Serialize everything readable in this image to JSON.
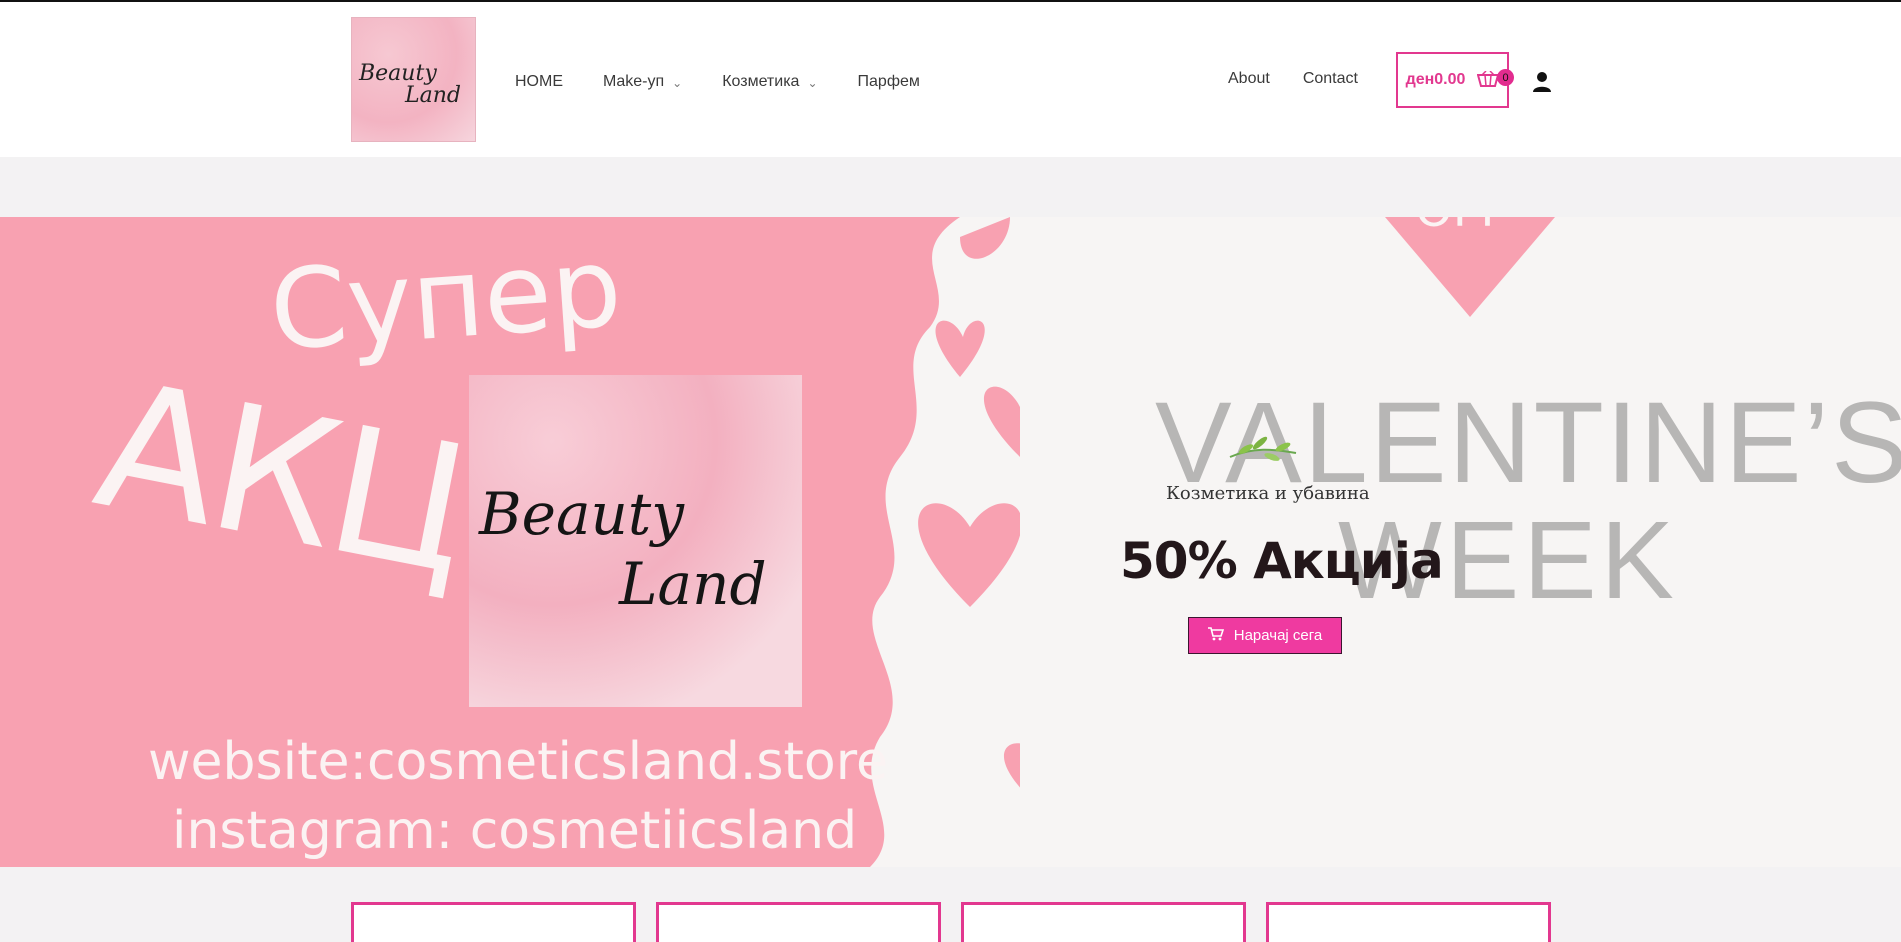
{
  "header": {
    "logo": {
      "line1": "Beauty",
      "line2": "Land"
    },
    "nav": [
      {
        "label": "HOME",
        "has_dropdown": false
      },
      {
        "label": "Make-уп",
        "has_dropdown": true
      },
      {
        "label": "Козметика",
        "has_dropdown": true
      },
      {
        "label": "Парфем",
        "has_dropdown": false
      }
    ],
    "nav_right": [
      {
        "label": "About"
      },
      {
        "label": "Contact"
      }
    ],
    "cart": {
      "price": "ден0.00",
      "count": "0",
      "icon": "cart-icon"
    },
    "account_icon": "user-icon"
  },
  "hero": {
    "banner": {
      "super_text": "Супер",
      "akc_text": "АКЦ",
      "logo_line1": "Beauty",
      "logo_line2": "Land",
      "website": "website:cosmeticsland.store",
      "instagram": "instagram: cosmetiicsland",
      "valentine": "VALENTINE’S",
      "week": "WEEK",
      "off": "OFF"
    },
    "subtitle": "Козметика и убавина",
    "headline": "50% Акција",
    "cta": {
      "label": "Нарачај сега",
      "icon": "cart-icon"
    }
  },
  "colors": {
    "accent": "#e2388f",
    "banner_pink": "#f8a1b1",
    "cta": "#ef3aa0"
  }
}
